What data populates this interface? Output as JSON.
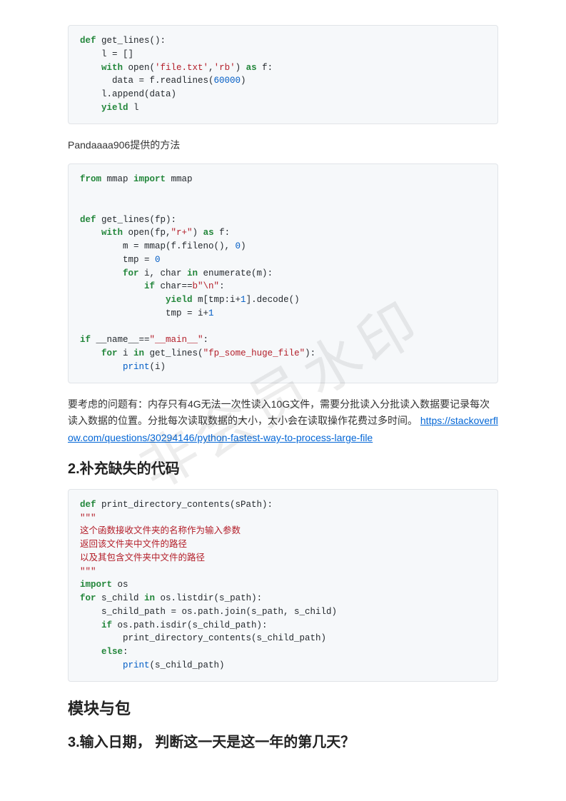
{
  "code1": {
    "l1a": "def",
    "l1b": " get_lines():",
    "l2": "    l = []",
    "l3a": "    with",
    "l3b": " open(",
    "l3c": "'file.txt'",
    "l3d": ",",
    "l3e": "'rb'",
    "l3f": ") ",
    "l3g": "as",
    "l3h": " f:",
    "l4": "      data = f.readlines(",
    "l4n": "60000",
    "l4e": ")",
    "l5": "    l.append(data)",
    "l6a": "    yield",
    "l6b": " l"
  },
  "para1": "Pandaaaa906提供的方法",
  "code2": {
    "l1a": "from",
    "l1b": " mmap ",
    "l1c": "import",
    "l1d": " mmap",
    "blank1": "",
    "blank2": "",
    "l2a": "def",
    "l2b": " get_lines(fp):",
    "l3a": "    with",
    "l3b": " open(fp,",
    "l3c": "\"r+\"",
    "l3d": ") ",
    "l3e": "as",
    "l3f": " f:",
    "l4": "        m = mmap(f.fileno(), ",
    "l4n": "0",
    "l4e": ")",
    "l5": "        tmp = ",
    "l5n": "0",
    "l6a": "        for",
    "l6b": " i, char ",
    "l6c": "in",
    "l6d": " enumerate(m):",
    "l7a": "            if",
    "l7b": " char==",
    "l7c": "b\"\\n\"",
    "l7d": ":",
    "l8a": "                yield",
    "l8b": " m[tmp:i+",
    "l8n": "1",
    "l8c": "].decode()",
    "l9": "                tmp = i+",
    "l9n": "1",
    "blank3": "",
    "l10a": "if",
    "l10b": " __name__==",
    "l10c": "\"__main__\"",
    "l10d": ":",
    "l11a": "    for",
    "l11b": " i ",
    "l11c": "in",
    "l11d": " get_lines(",
    "l11e": "\"fp_some_huge_file\"",
    "l11f": "):",
    "l12a": "        print",
    "l12b": "(i)"
  },
  "para2": "要考虑的问题有：内存只有4G无法一次性读入10G文件，需要分批读入分批读入数据要记录每次读入数据的位置。分批每次读取数据的大小，太小会在读取操作花费过多时间。",
  "link1": "https://stackoverflow.com/questions/30294146/python-fastest-way-to-process-large-file",
  "h2a": "2.补充缺失的代码",
  "code3": {
    "l1a": "def",
    "l1b": " print_directory_contents(sPath):",
    "l2": "\"\"\"",
    "l3": "这个函数接收文件夹的名称作为输入参数",
    "l4": "返回该文件夹中文件的路径",
    "l5": "以及其包含文件夹中文件的路径",
    "l6": "\"\"\"",
    "l7a": "import",
    "l7b": " os",
    "l8a": "for",
    "l8b": " s_child ",
    "l8c": "in",
    "l8d": " os.listdir(s_path):",
    "l9": "    s_child_path = os.path.join(s_path, s_child)",
    "l10a": "    if",
    "l10b": " os.path.isdir(s_child_path):",
    "l11": "        print_directory_contents(s_child_path)",
    "l12a": "    else",
    "l12b": ":",
    "l13a": "        print",
    "l13b": "(s_child_path)"
  },
  "h2b": "模块与包",
  "h2c": "3.输入日期，  判断这一天是这一年的第几天？",
  "watermark": "非会员水印"
}
